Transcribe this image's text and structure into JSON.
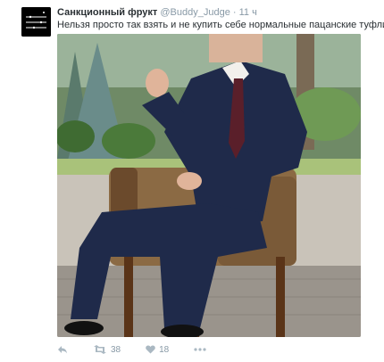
{
  "tweet": {
    "author_name": "Санкционный фрукт",
    "handle": "@Buddy_Judge",
    "separator": "·",
    "time": "11 ч",
    "text": "Нельзя просто так взять и не купить себе нормальные пацанские туфли.",
    "retweets": "38",
    "likes": "18"
  },
  "icons": {
    "reply": "reply-icon",
    "retweet": "retweet-icon",
    "like": "heart-icon",
    "more": "more-icon"
  },
  "colors": {
    "text": "#292f33",
    "secondary": "#8899a6",
    "icon": "#aab8c2"
  }
}
